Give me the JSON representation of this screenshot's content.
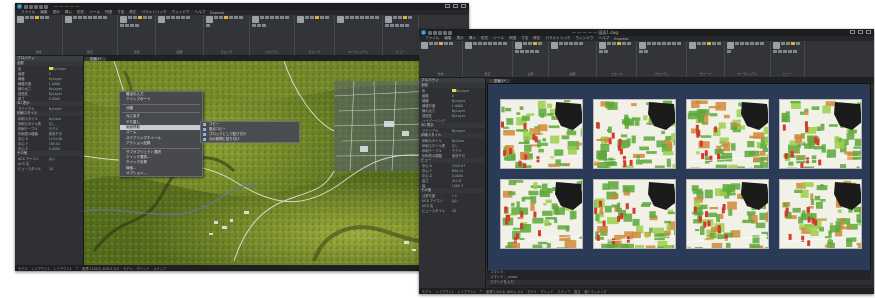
{
  "colors": {
    "app_bg": "#2b2d30",
    "ribbon_bg": "#323438",
    "panel_bg": "#2e3033",
    "model_bg": "#2a3a57",
    "context_highlight": "#c7cbd1",
    "map_green": "#6f8a2a"
  },
  "windows": [
    {
      "title": "— — — — —",
      "menu": [
        "ファイル",
        "編集",
        "表示",
        "挿入",
        "形式",
        "ツール",
        "作図",
        "寸法",
        "修正",
        "パラメトリック",
        "ウィンドウ",
        "ヘルプ",
        "Express"
      ],
      "ribbon_groups": [
        {
          "label": "作成",
          "width": 48
        },
        {
          "label": "修正",
          "width": 55
        },
        {
          "label": "注釈",
          "width": 38
        },
        {
          "label": "画層",
          "width": 48
        },
        {
          "label": "ブロック",
          "width": 46
        },
        {
          "label": "プロパティ",
          "width": 45
        },
        {
          "label": "グループ",
          "width": 40
        },
        {
          "label": "ユーティリティ",
          "width": 48
        },
        {
          "label": "ビュー",
          "width": 36
        }
      ],
      "tab": "図面1*",
      "panel": {
        "title": "プロパティ",
        "sections": [
          {
            "name": "全般",
            "rows": [
              [
                "色",
                "ByLayer"
              ],
              [
                "画層",
                "0"
              ],
              [
                "線種",
                "ByLayer"
              ],
              [
                "線種尺度",
                "1.0000"
              ],
              [
                "線の太さ",
                "ByLayer"
              ],
              [
                "透過性",
                "ByLayer"
              ],
              [
                "厚さ",
                "0.0000"
              ]
            ]
          },
          {
            "name": "3D 表示",
            "rows": [
              [
                "マテリアル",
                "ByLayer"
              ]
            ]
          },
          {
            "name": "印刷スタイル",
            "rows": [
              [
                "印刷スタイル",
                "ByColor"
              ],
              [
                "印刷スタイル表",
                "なし"
              ],
              [
                "印刷テーブル",
                "モデル"
              ],
              [
                "印刷表の種類",
                "使用不可"
              ],
              [
                "中心 X",
                "1234.56"
              ],
              [
                "中心 Y",
                "789.01"
              ],
              [
                "中心 Z",
                "0.0000"
              ]
            ]
          },
          {
            "name": "その他",
            "rows": [
              [
                "UCS アイコン",
                "はい"
              ],
              [
                "UCS 名",
                ""
              ],
              [
                "ビュースタイル",
                "2D"
              ]
            ]
          }
        ]
      },
      "context_menu": {
        "items": [
          "最近の入力",
          "クリップボード",
          "",
          "分離",
          "",
          "元に戻す",
          "やり直し",
          "画面移動",
          "ズーム",
          "ステアリングホイール",
          "アクション記録",
          "",
          "サブオブジェクト選択",
          "クイック選択...",
          "クイック計算",
          "検索...",
          "オプション..."
        ],
        "highlight_index": 7,
        "submenu": [
          "コピー",
          "基点コピー",
          "ブロックとして貼り付け",
          "元の座標に貼り付け"
        ]
      },
      "status": [
        "モデル",
        "レイアウト1",
        "レイアウト2",
        "+",
        "座標 1234.5, 678.9, 0.0",
        "モデル",
        "グリッド",
        "スナップ"
      ]
    },
    {
      "title": "— — — — — 図面1.dwg",
      "menu": [
        "ファイル",
        "編集",
        "表示",
        "挿入",
        "形式",
        "ツール",
        "作図",
        "寸法",
        "修正",
        "パラメトリック",
        "ウィンドウ",
        "ヘルプ",
        "Express"
      ],
      "ribbon_groups": [
        {
          "label": "作成",
          "width": 44
        },
        {
          "label": "修正",
          "width": 50
        },
        {
          "label": "注釈",
          "width": 36
        },
        {
          "label": "画層",
          "width": 48
        },
        {
          "label": "ブロック",
          "width": 40
        },
        {
          "label": "プロパティ",
          "width": 50
        },
        {
          "label": "グループ",
          "width": 38
        },
        {
          "label": "ユーティリティ",
          "width": 46
        },
        {
          "label": "ビュー",
          "width": 34
        }
      ],
      "tab": "図面1*",
      "panel": {
        "title": "プロパティ",
        "sections": [
          {
            "name": "全般",
            "rows": [
              [
                "色",
                "ByLayer"
              ],
              [
                "画層",
                "0"
              ],
              [
                "線種",
                "ByLayer"
              ],
              [
                "線種尺度",
                "1.0000"
              ],
              [
                "線の太さ",
                "ByLayer"
              ],
              [
                "透過性",
                "ByLayer"
              ],
              [
                "ハイパーリンク",
                ""
              ]
            ]
          },
          {
            "name": "3D 表示",
            "rows": [
              [
                "マテリアル",
                "ByLayer"
              ]
            ]
          },
          {
            "name": "印刷スタイル",
            "rows": [
              [
                "印刷スタイル",
                "ByColor"
              ],
              [
                "印刷スタイル表",
                "なし"
              ],
              [
                "印刷テーブル",
                "モデル"
              ],
              [
                "印刷表の種類",
                "使用不可"
              ]
            ]
          },
          {
            "name": "ビュー",
            "rows": [
              [
                "中心 X",
                "2345.67"
              ],
              [
                "中心 Y",
                "890.12"
              ],
              [
                "中心 Z",
                "0.0000"
              ],
              [
                "高さ",
                "412.8"
              ],
              [
                "幅",
                "1065.3"
              ]
            ]
          },
          {
            "name": "その他",
            "rows": [
              [
                "注釈尺度",
                "1:1"
              ],
              [
                "UCS アイコン",
                "はい"
              ],
              [
                "UCS 名",
                ""
              ],
              [
                "ビュースタイル",
                "2D"
              ]
            ]
          }
        ]
      },
      "thumbnails": 8,
      "command_lines": [
        "コマンド:",
        "コマンド: _.close",
        "コマンドを入力"
      ],
      "status": [
        "モデル",
        "レイアウト1",
        "レイアウト2",
        "+",
        "座標 2345.6, 890.1, 0.0",
        "モデル",
        "グリッド",
        "スナップ",
        "直交",
        "極トラッキング"
      ]
    }
  ]
}
